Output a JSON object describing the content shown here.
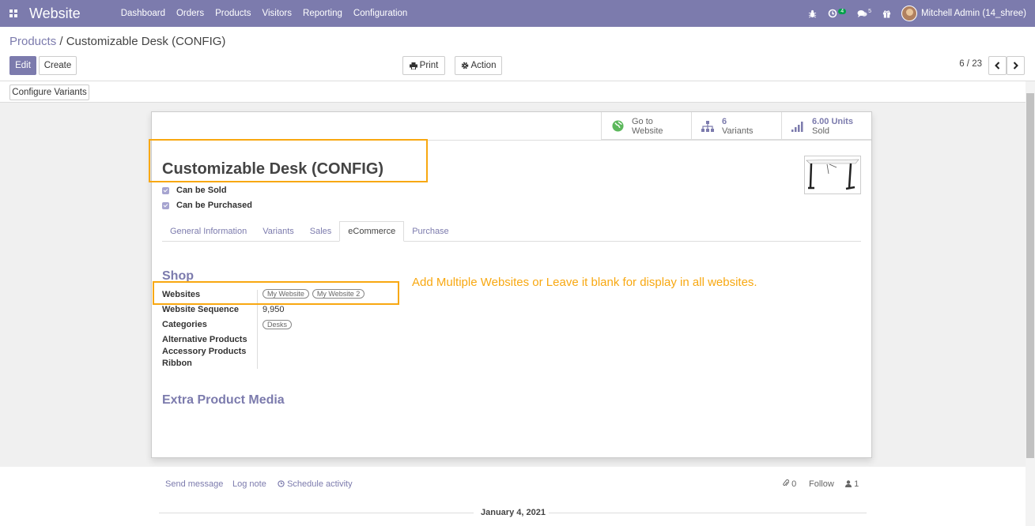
{
  "navbar": {
    "app_name": "Website",
    "menu": [
      "Dashboard",
      "Orders",
      "Products",
      "Visitors",
      "Reporting",
      "Configuration"
    ],
    "activity_count": "4",
    "messages_count": "5",
    "user": "Mitchell Admin (14_shree)"
  },
  "breadcrumb": {
    "parent": "Products",
    "separator": "/",
    "current": "Customizable Desk (CONFIG)"
  },
  "buttons": {
    "edit": "Edit",
    "create": "Create",
    "print": "Print",
    "action": "Action",
    "configure_variants": "Configure Variants"
  },
  "pager": {
    "text": "6 / 23"
  },
  "smart_buttons": {
    "website_line1": "Go to",
    "website_line2": "Website",
    "variants_num": "6",
    "variants_label": "Variants",
    "sold_num": "6.00 Units",
    "sold_label": "Sold"
  },
  "product": {
    "name": "Customizable Desk (CONFIG)",
    "can_be_sold": "Can be Sold",
    "can_be_purchased": "Can be Purchased"
  },
  "tabs": [
    "General Information",
    "Variants",
    "Sales",
    "eCommerce",
    "Purchase"
  ],
  "shop": {
    "section": "Shop",
    "websites_label": "Websites",
    "websites": [
      "My Website",
      "My Website 2"
    ],
    "sequence_label": "Website Sequence",
    "sequence_value": "9,950",
    "categories_label": "Categories",
    "categories": [
      "Desks"
    ],
    "alternative_label": "Alternative Products",
    "accessory_label": "Accessory Products",
    "ribbon_label": "Ribbon"
  },
  "note": "Add Multiple Websites or Leave it blank for display in all websites.",
  "extra_media": "Extra Product Media",
  "chatter": {
    "send_message": "Send message",
    "log_note": "Log note",
    "schedule_activity": "Schedule activity",
    "attachments": "0",
    "follow": "Follow",
    "followers": "1",
    "date": "January 4, 2021"
  },
  "colors": {
    "navbar": "#7c7bad",
    "highlight": "#f8a811",
    "link": "#7c7bad"
  }
}
